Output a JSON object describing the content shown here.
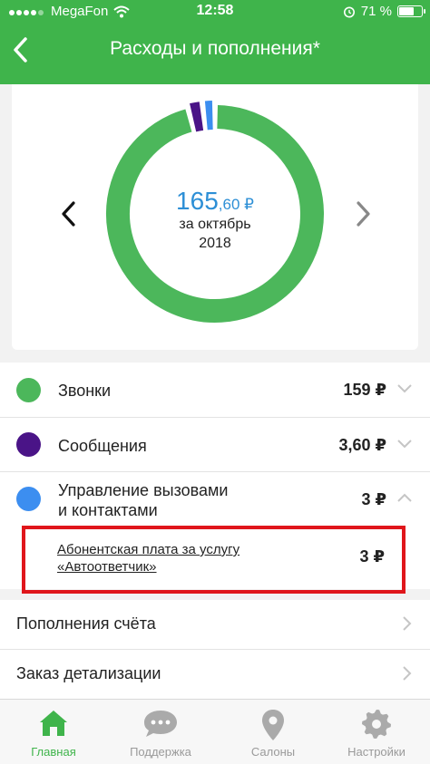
{
  "status_bar": {
    "carrier": "MegaFon",
    "time": "12:58",
    "battery_percent": "71 %",
    "battery_level": 0.71
  },
  "header": {
    "title": "Расходы и пополнения*"
  },
  "summary": {
    "amount_main": "165",
    "amount_fraction": ",60 ₽",
    "period_line1": "за октябрь",
    "period_line2": "2018"
  },
  "chart_data": {
    "type": "pie",
    "categories": [
      "Звонки",
      "Сообщения",
      "Управление вызовами и контактами"
    ],
    "values": [
      159,
      3.6,
      3
    ],
    "colors": [
      "#4cb75b",
      "#4a1487",
      "#3c8ef0"
    ]
  },
  "categories": [
    {
      "label_line1": "Звонки",
      "label_line2": "",
      "value": "159 ₽",
      "color": "#4cb75b",
      "expanded": false
    },
    {
      "label_line1": "Сообщения",
      "label_line2": "",
      "value": "3,60 ₽",
      "color": "#4a1487",
      "expanded": false
    },
    {
      "label_line1": "Управление вызовами",
      "label_line2": "и контактами",
      "value": "3 ₽",
      "color": "#3c8ef0",
      "expanded": true
    }
  ],
  "sub_item": {
    "label_line1": "Абонентская плата за услугу",
    "label_line2": "«Автоответчик»",
    "value": "3 ₽"
  },
  "links": [
    {
      "label": "Пополнения счёта"
    },
    {
      "label": "Заказ детализации"
    }
  ],
  "tabs": [
    {
      "label": "Главная",
      "icon": "home-icon",
      "active": true
    },
    {
      "label": "Поддержка",
      "icon": "chat-bubble-icon",
      "active": false
    },
    {
      "label": "Салоны",
      "icon": "map-pin-icon",
      "active": false
    },
    {
      "label": "Настройки",
      "icon": "gear-icon",
      "active": false
    }
  ],
  "colors": {
    "brand_green": "#3fb44b",
    "accent_blue": "#2d8fd6",
    "highlight_red": "#e0161b"
  }
}
